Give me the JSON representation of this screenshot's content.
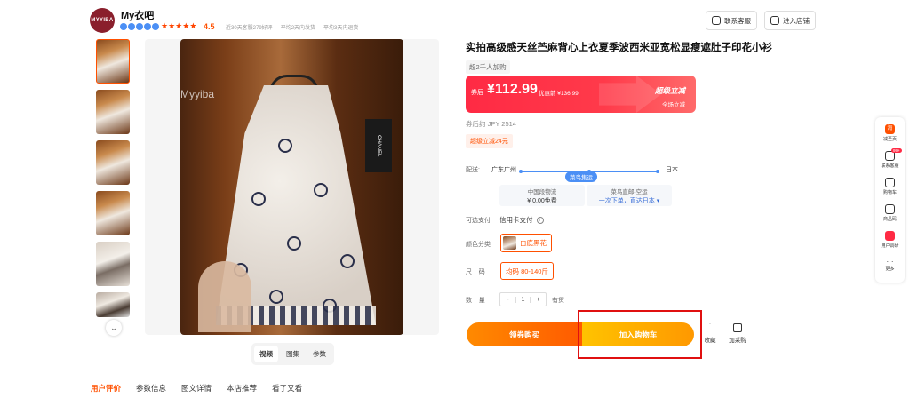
{
  "shop": {
    "logo_text": "MYYIBA",
    "name": "My衣吧",
    "rating": "4.5",
    "stats": [
      "近30天客服279好评",
      "平均2天内发货",
      "平均3天内退货"
    ]
  },
  "header": {
    "customer_service": "联系客服",
    "enter_shop": "进入店铺"
  },
  "gallery": {
    "watermark": "Myyiba",
    "tabs": [
      "视频",
      "图集",
      "参数"
    ],
    "active_tab": "视频"
  },
  "bottom_tabs": [
    "用户评价",
    "参数信息",
    "图文详情",
    "本店推荐",
    "看了又看"
  ],
  "product": {
    "title": "实拍高级感天丝苎麻背心上衣夏季波西米亚宽松显瘦遮肚子印花小衫",
    "sales": "超2千人加购",
    "price_label": "券后",
    "price": "¥112.99",
    "original_price": "优惠前 ¥136.99",
    "promo_title": "超级立减",
    "promo_sub": "全场立减",
    "jpy": "券后约 JPY 2514",
    "coupon_tag": "超级立减24元"
  },
  "delivery": {
    "label": "配送:",
    "from": "广东广州",
    "to": "日本",
    "tag": "菜鸟集运",
    "domestic_title": "中国段物流",
    "domestic_value": "¥ 0.00免费",
    "intl_title": "菜鸟直邮-空运",
    "intl_value": "一次下单，直达日本 ▾"
  },
  "payment": {
    "label": "可选支付",
    "value": "信用卡支付"
  },
  "color": {
    "label": "颜色分类",
    "option": "白底黑花"
  },
  "size": {
    "label": "尺    码",
    "option": "均码 80-140斤"
  },
  "quantity": {
    "label": "数    量",
    "minus": "-",
    "value": "1",
    "plus": "+",
    "stock": "有货"
  },
  "actions": {
    "buy_now": "领券购买",
    "add_to_cart": "加入购物车",
    "favorite": "收藏",
    "add_purchase": "加采购"
  },
  "right_sidebar": [
    "减至页",
    "联系客服",
    "购物车",
    "商品码",
    "用户调研",
    "更多"
  ],
  "right_sidebar_badge": "99+",
  "chanel_text": "CHANEL"
}
